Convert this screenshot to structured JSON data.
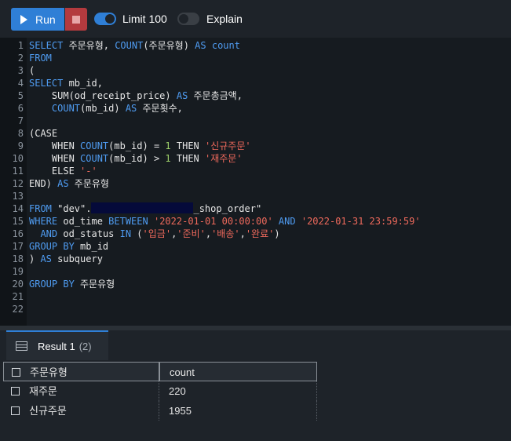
{
  "toolbar": {
    "run_label": "Run",
    "limit_label": "Limit 100",
    "limit_enabled": true,
    "explain_label": "Explain",
    "explain_enabled": false,
    "accent_color": "#2f7fd6",
    "stop_color": "#b33a3e"
  },
  "editor": {
    "line_numbers": [
      "1",
      "2",
      "3",
      "4",
      "5",
      "6",
      "7",
      "8",
      "9",
      "10",
      "11",
      "12",
      "13",
      "14",
      "15",
      "16",
      "17",
      "18",
      "19",
      "20",
      "21",
      "22"
    ],
    "lines": [
      "SELECT 주문유형, COUNT(주문유형) AS count",
      "FROM",
      "(",
      "SELECT mb_id,",
      "    SUM(od_receipt_price) AS 주문총금액,",
      "    COUNT(mb_id) AS 주문횟수,",
      "",
      "(CASE",
      "    WHEN COUNT(mb_id) = 1 THEN '신규주문'",
      "    WHEN COUNT(mb_id) > 1 THEN '재주문'",
      "    ELSE '-'",
      "END) AS 주문유형",
      "",
      "FROM \"dev\".[redacted]_shop_order\"",
      "WHERE od_time BETWEEN '2022-01-01 00:00:00' AND '2022-01-31 23:59:59'",
      "  AND od_status IN ('입금','준비','배송','완료')",
      "GROUP BY mb_id",
      ") AS subquery",
      "",
      "GROUP BY 주문유형",
      "",
      ""
    ]
  },
  "results": {
    "tab_label": "Result 1",
    "tab_count": "(2)",
    "columns": [
      "주문유형",
      "count"
    ],
    "rows": [
      [
        "재주문",
        "220"
      ],
      [
        "신규주문",
        "1955"
      ]
    ]
  }
}
